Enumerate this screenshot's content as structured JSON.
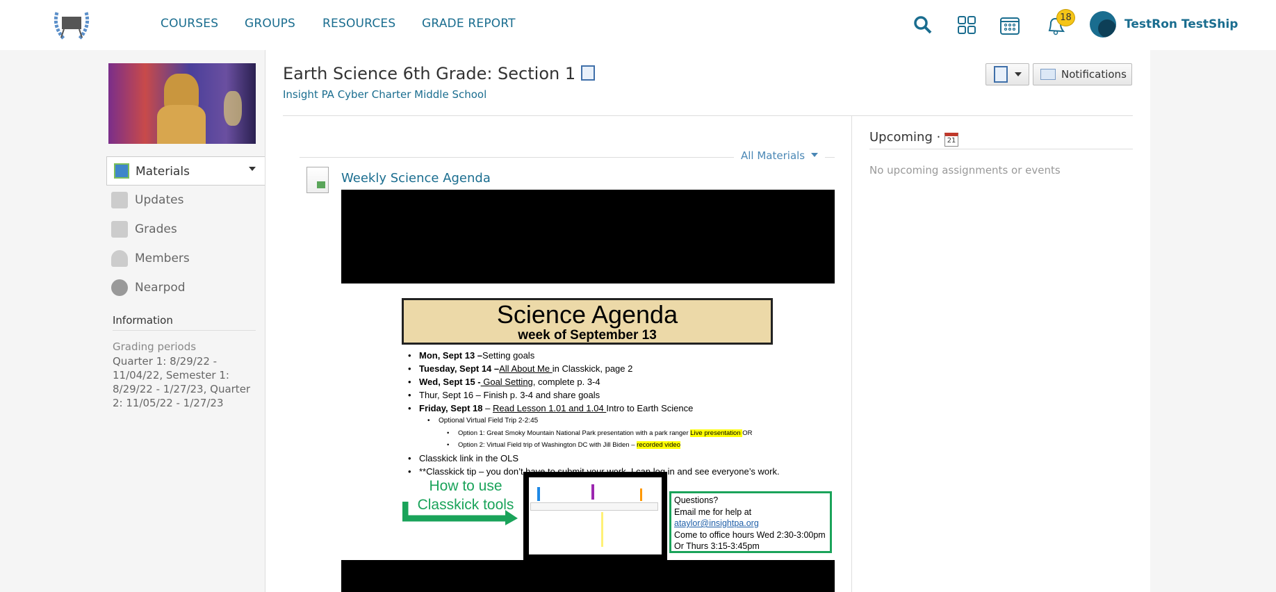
{
  "header": {
    "nav": [
      "COURSES",
      "GROUPS",
      "RESOURCES",
      "GRADE REPORT"
    ],
    "notification_count": "18",
    "user_name": "TestRon TestShip",
    "icons": [
      "search-icon",
      "apps-grid-icon",
      "calendar-icon",
      "bell-icon"
    ]
  },
  "sidebar": {
    "items": [
      {
        "label": "Materials",
        "active": true
      },
      {
        "label": "Updates"
      },
      {
        "label": "Grades"
      },
      {
        "label": "Members"
      },
      {
        "label": "Nearpod"
      }
    ],
    "info_heading": "Information",
    "grading_label": "Grading periods",
    "grading_text": "Quarter 1: 8/29/22 - 11/04/22, Semester 1: 8/29/22 - 1/27/23, Quarter 2: 11/05/22 - 1/27/23"
  },
  "course": {
    "title": "Earth Science 6th Grade: Section 1",
    "school": "Insight PA Cyber Charter Middle School",
    "notifications_button": "Notifications"
  },
  "materials": {
    "filter": "All Materials",
    "item_title": "Weekly Science Agenda"
  },
  "upcoming": {
    "heading": "Upcoming ·",
    "calendar_day": "21",
    "empty": "No upcoming assignments or events"
  },
  "slide": {
    "title": "Science Agenda",
    "subtitle": "week of September 13",
    "b1_bold": "Mon, Sept 13 –",
    "b1": "Setting goals",
    "b2_bold": "Tuesday, Sept 14 –",
    "b2_link": "All About Me ",
    "b2": "in Classkick, page 2",
    "b3_bold": "Wed, Sept 15 -",
    "b3_link": " Goal Setting",
    "b3": ", complete p. 3-4",
    "b4": "Thur, Sept 16 – Finish p. 3-4 and share goals",
    "b5_bold": "Friday, Sept 18",
    "b5_pre": " – ",
    "b5_link": "Read Lesson 1.01 and 1.04 ",
    "b5": "Intro to Earth Science",
    "sub1": "Optional Virtual Field Trip 2-2:45",
    "opt1": "Option 1: Great Smoky Mountain National Park presentation with a park ranger ",
    "opt1_hl": "Live presentation ",
    "opt1_end": " OR",
    "opt2": "Option 2: Virtual Field trip of Washington DC with Jill Biden – ",
    "opt2_hl": "recorded video",
    "b6": "Classkick link in the OLS",
    "b7": "**Classkick tip – you don’t have to submit your work, I can log in and see everyone’s work.",
    "howto1": "How to use",
    "howto2": "Classkick tools",
    "q1": "Questions?",
    "q2": "Email me for help at",
    "q_email": "ataylor@insightpa.org",
    "q3": "Come to office hours Wed 2:30-3:00pm",
    "q4": "Or Thurs 3:15-3:45pm"
  }
}
